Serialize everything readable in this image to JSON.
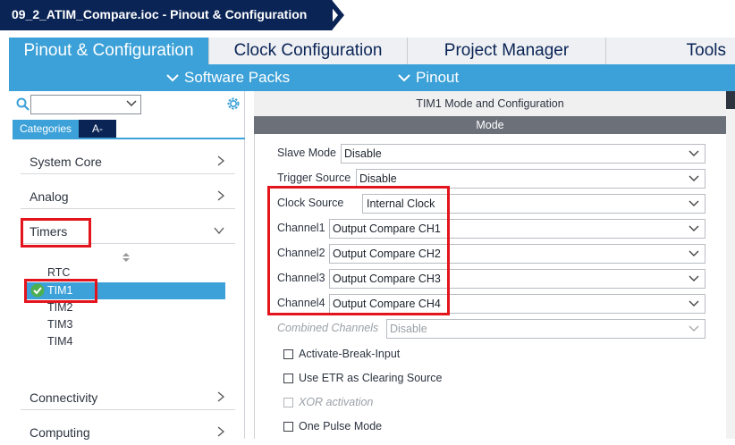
{
  "title": "09_2_ATIM_Compare.ioc - Pinout & Configuration",
  "tabs": {
    "pinout": "Pinout & Configuration",
    "clock": "Clock Configuration",
    "project": "Project Manager",
    "tools": "Tools"
  },
  "subbar": {
    "software_packs": "Software Packs",
    "pinout": "Pinout"
  },
  "sidebar": {
    "search_placeholder": "",
    "cat_tabs": {
      "categories": "Categories",
      "az": "A->Z"
    },
    "categories": {
      "system_core": "System Core",
      "analog": "Analog",
      "timers": "Timers",
      "connectivity": "Connectivity",
      "computing": "Computing"
    },
    "timers_items": {
      "rtc": "RTC",
      "tim1": "TIM1",
      "tim2": "TIM2",
      "tim3": "TIM3",
      "tim4": "TIM4"
    }
  },
  "panel": {
    "title": "TIM1 Mode and Configuration",
    "mode_header": "Mode",
    "fields": {
      "slave_mode": {
        "label": "Slave Mode",
        "value": "Disable"
      },
      "trigger_source": {
        "label": "Trigger Source",
        "value": "Disable"
      },
      "clock_source": {
        "label": "Clock Source",
        "value": "Internal Clock"
      },
      "channel1": {
        "label": "Channel1",
        "value": "Output Compare CH1"
      },
      "channel2": {
        "label": "Channel2",
        "value": "Output Compare CH2"
      },
      "channel3": {
        "label": "Channel3",
        "value": "Output Compare CH3"
      },
      "channel4": {
        "label": "Channel4",
        "value": "Output Compare CH4"
      },
      "combined_channels": {
        "label": "Combined Channels",
        "value": "Disable"
      }
    },
    "checkboxes": {
      "activate_break": "Activate-Break-Input",
      "use_etr": "Use ETR as Clearing Source",
      "xor": "XOR activation",
      "one_pulse": "One Pulse Mode"
    }
  },
  "colors": {
    "navy": "#0a2456",
    "accent": "#3ca1d8",
    "highlight": "#e3141c"
  }
}
